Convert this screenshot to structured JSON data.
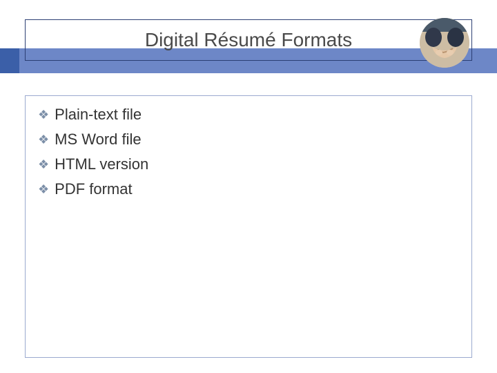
{
  "title": "Digital Résumé Formats",
  "bullets": [
    {
      "label": "Plain-text file"
    },
    {
      "label": "MS Word file"
    },
    {
      "label": "HTML version"
    },
    {
      "label": "PDF format"
    }
  ],
  "colors": {
    "band": "#6d87c7",
    "accent": "#3b5fa8",
    "titleBorder": "#2b3f73",
    "bulletIcon": "#7c8fa8"
  }
}
